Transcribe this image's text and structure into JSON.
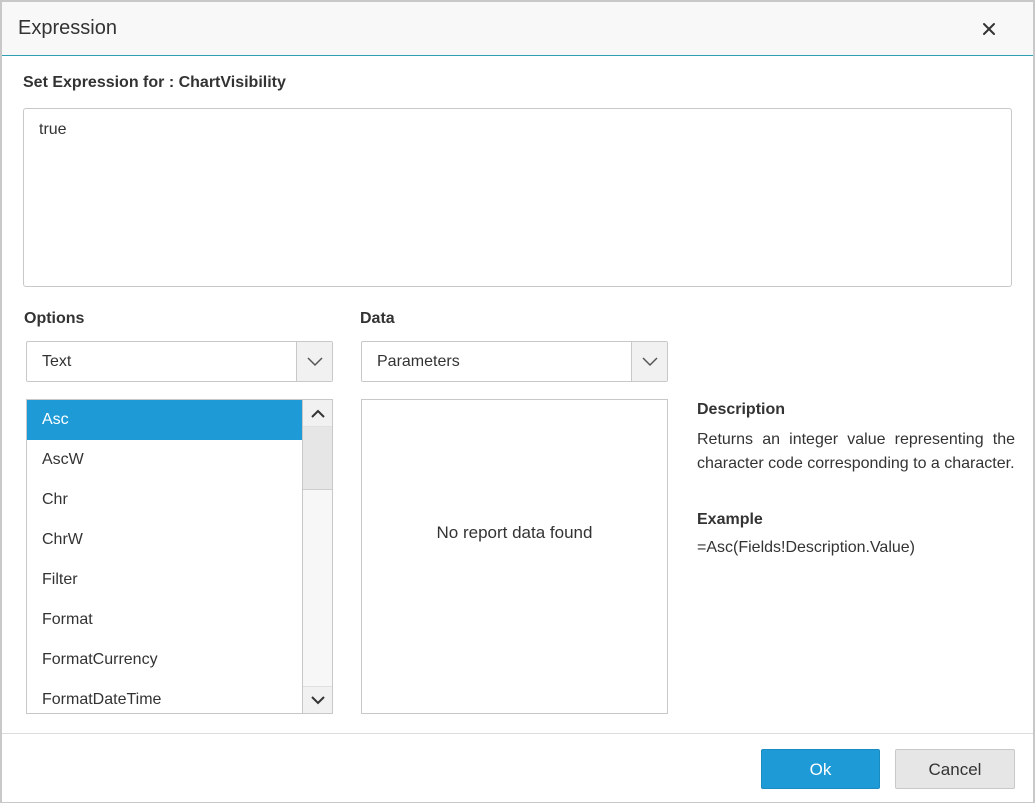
{
  "dialog": {
    "title": "Expression",
    "close_icon": "close-icon"
  },
  "expression": {
    "label": "Set Expression for : ChartVisibility",
    "value": "true"
  },
  "options": {
    "label": "Options",
    "selected": "Text",
    "functions": [
      "Asc",
      "AscW",
      "Chr",
      "ChrW",
      "Filter",
      "Format",
      "FormatCurrency",
      "FormatDateTime"
    ],
    "selected_function": "Asc"
  },
  "data": {
    "label": "Data",
    "selected": "Parameters",
    "empty_message": "No report data found"
  },
  "description": {
    "heading": "Description",
    "text": "Returns an integer value representing the character code corresponding to a character.",
    "example_heading": "Example",
    "example": "=Asc(Fields!Description.Value)"
  },
  "footer": {
    "ok_label": "Ok",
    "cancel_label": "Cancel"
  },
  "colors": {
    "accent": "#1e9bd6",
    "header_border": "#2f9fb3"
  }
}
